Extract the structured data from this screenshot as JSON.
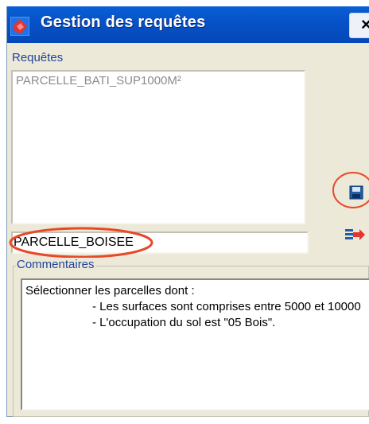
{
  "window": {
    "title": "Gestion des requêtes",
    "close_label": "×"
  },
  "requetes": {
    "label": "Requêtes",
    "items": [
      "PARCELLE_BATI_SUP1000M²"
    ]
  },
  "name_field": {
    "value": "PARCELLE_BOISEE"
  },
  "commentaires": {
    "label": "Commentaires",
    "lines": [
      "Sélectionner les parcelles dont :",
      "- Les surfaces sont comprises entre 5000 et 10000",
      "- L'occupation du sol est \"05 Bois\"."
    ]
  },
  "icons": {
    "app": "app-icon",
    "save": "save-icon",
    "export": "export-icon"
  },
  "colors": {
    "titlebar": "#0752c8",
    "label": "#21439c",
    "highlight": "#e8482a",
    "background": "#ece9d8"
  }
}
